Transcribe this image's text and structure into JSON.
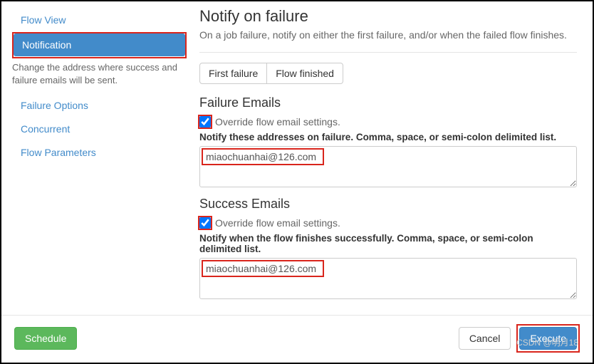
{
  "sidebar": {
    "items": [
      {
        "label": "Flow View"
      },
      {
        "label": "Notification"
      },
      {
        "label": "Failure Options"
      },
      {
        "label": "Concurrent"
      },
      {
        "label": "Flow Parameters"
      }
    ],
    "desc": "Change the address where success and failure emails will be sent."
  },
  "main": {
    "title": "Notify on failure",
    "subtitle": "On a job failure, notify on either the first failure, and/or when the failed flow finishes.",
    "seg": {
      "first": "First failure",
      "finished": "Flow finished"
    },
    "failure": {
      "heading": "Failure Emails",
      "override": "Override flow email settings.",
      "label": "Notify these addresses on failure. Comma, space, or semi-colon delimited list.",
      "value": "miaochuanhai@126.com"
    },
    "success": {
      "heading": "Success Emails",
      "override": "Override flow email settings.",
      "label": "Notify when the flow finishes successfully. Comma, space, or semi-colon delimited list.",
      "value": "miaochuanhai@126.com"
    }
  },
  "footer": {
    "schedule": "Schedule",
    "cancel": "Cancel",
    "execute": "Execute"
  },
  "watermark": "CSDN @明月18"
}
